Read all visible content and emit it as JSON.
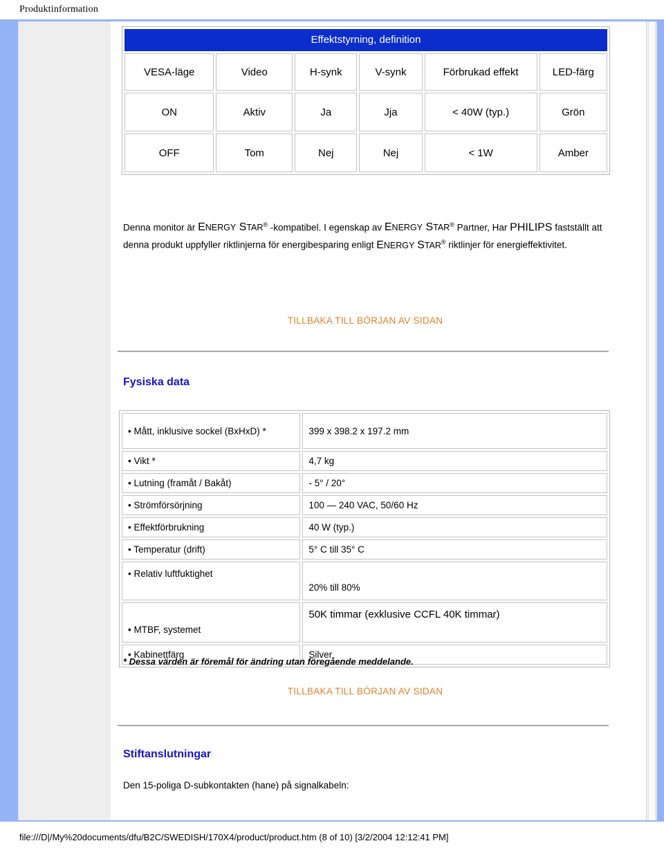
{
  "document": {
    "title": "Produktinformation"
  },
  "power_table": {
    "caption": "Effektstyrning, definition",
    "headers": [
      "VESA-läge",
      "Video",
      "H-synk",
      "V-synk",
      "Förbrukad effekt",
      "LED-färg"
    ],
    "rows": [
      [
        "ON",
        "Aktiv",
        "Ja",
        "Jja",
        "< 40W (typ.)",
        "Grön"
      ],
      [
        "OFF",
        "Tom",
        "Nej",
        "Nej",
        "< 1W",
        "Amber"
      ]
    ]
  },
  "energy_star_paragraph": {
    "part1": "Denna monitor är ",
    "brand1_big": "E",
    "brand1_small": "NERGY",
    "brand1_big2": " S",
    "brand1_small2": "TAR",
    "part2": " -kompatibel. I egenskap av ",
    "brand2_big": "E",
    "brand2_small": "NERGY",
    "brand2_big2": " S",
    "brand2_small2": "TAR",
    "part3": " Partner, Har ",
    "philips": "PHILIPS",
    "part4": " fastställt att denna produkt uppfyller riktlinjerna för energibesparing enligt ",
    "brand3_big": "E",
    "brand3_small": "NERGY",
    "brand3_big2": "S",
    "brand3_small2": "TAR",
    "part5": " riktlinjer för energieffektivitet.",
    "registered": "®"
  },
  "links": {
    "back_to_top": "TILLBAKA TILL BÖRJAN AV SIDAN"
  },
  "physical_section": {
    "heading": "Fysiska data",
    "rows": [
      {
        "label": "• Mått, inklusive sockel (BxHxD) *",
        "value": "399 x 398.2 x 197.2 mm"
      },
      {
        "label": "• Vikt *",
        "value": "4,7 kg"
      },
      {
        "label": "• Lutning (framåt / Bakåt)",
        "value": "- 5° / 20°"
      },
      {
        "label": "• Strömförsörjning",
        "value": "100 — 240 VAC, 50/60 Hz"
      },
      {
        "label": "• Effektförbrukning",
        "value": "40 W (typ.)"
      },
      {
        "label": "• Temperatur (drift)",
        "value": "5° C till 35° C"
      },
      {
        "label": "• Relativ luftfuktighet",
        "value": "20% till 80%"
      },
      {
        "label": "• MTBF, systemet",
        "value": "50K timmar (exklusive CCFL 40K timmar)"
      },
      {
        "label": "• Kabinettfärg",
        "value": "Silver"
      }
    ],
    "footnote": "* Dessa värden är föremål för ändring utan föregående meddelande."
  },
  "pin_section": {
    "heading": "Stiftanslutningar",
    "paragraph": "Den 15-poliga D-subkontakten (hane) på signalkabeln:"
  },
  "status_bar": {
    "path": "file:///D|/My%20documents/dfu/B2C/SWEDISH/170X4/product/product.htm (8 of 10) [3/2/2004 12:12:41 PM]"
  },
  "colors": {
    "table_header_blue": "#0b2dcb",
    "heading_blue": "#1414cc",
    "link_orange": "#e1822c",
    "frame_blue": "#94b3f4",
    "sidebar_gray": "#eeeeee"
  }
}
